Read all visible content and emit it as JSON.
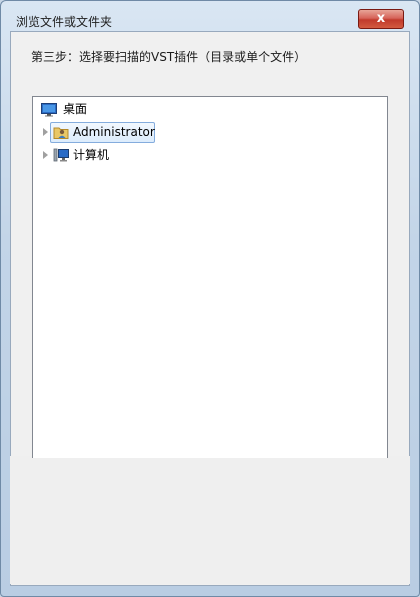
{
  "window": {
    "title": "浏览文件或文件夹",
    "close_label": "x"
  },
  "instruction": "第三步：选择要扫描的VST插件（目录或单个文件）",
  "tree": {
    "items": [
      {
        "label": "桌面",
        "icon": "desktop-icon",
        "expanded": false,
        "has_children": false
      },
      {
        "label": "Administrator",
        "icon": "user-folder-icon",
        "selected": true,
        "has_children": true
      },
      {
        "label": "计算机",
        "icon": "computer-icon",
        "has_children": true
      }
    ]
  },
  "colors": {
    "selection_border": "#84acdd",
    "selection_fill": "#dcecfc",
    "close_button": "#c13a2c"
  }
}
